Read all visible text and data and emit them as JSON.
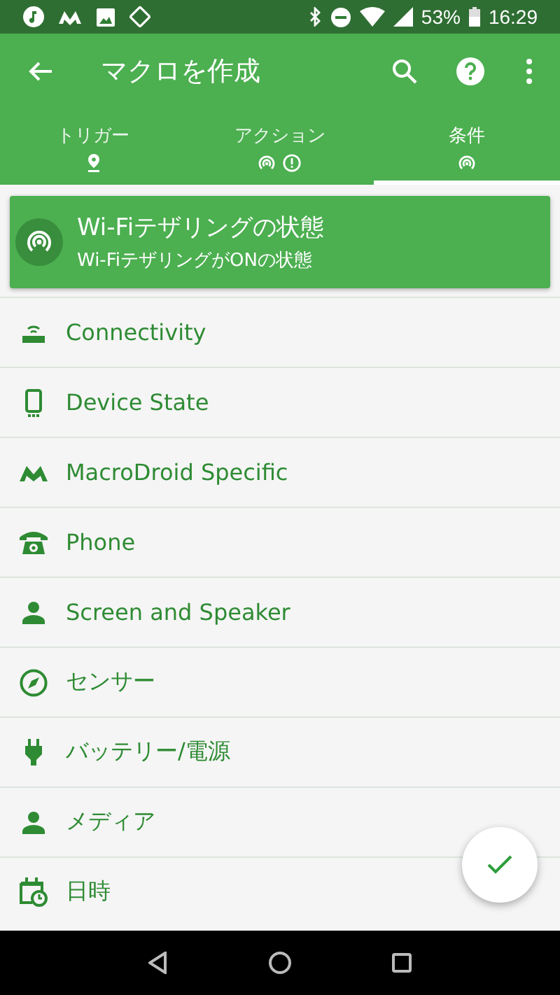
{
  "status_bar": {
    "battery": "53%",
    "time": "16:29"
  },
  "app_bar": {
    "title": "マクロを作成"
  },
  "tabs": [
    {
      "label": "トリガー",
      "selected": false
    },
    {
      "label": "アクション",
      "selected": false
    },
    {
      "label": "条件",
      "selected": true
    }
  ],
  "selected_condition": {
    "title": "Wi-Fiテザリングの状態",
    "subtitle": "Wi-FiテザリングがONの状態"
  },
  "categories": [
    "Connectivity",
    "Device State",
    "MacroDroid Specific",
    "Phone",
    "Screen and Speaker",
    "センサー",
    "バッテリー/電源",
    "メディア",
    "日時"
  ]
}
